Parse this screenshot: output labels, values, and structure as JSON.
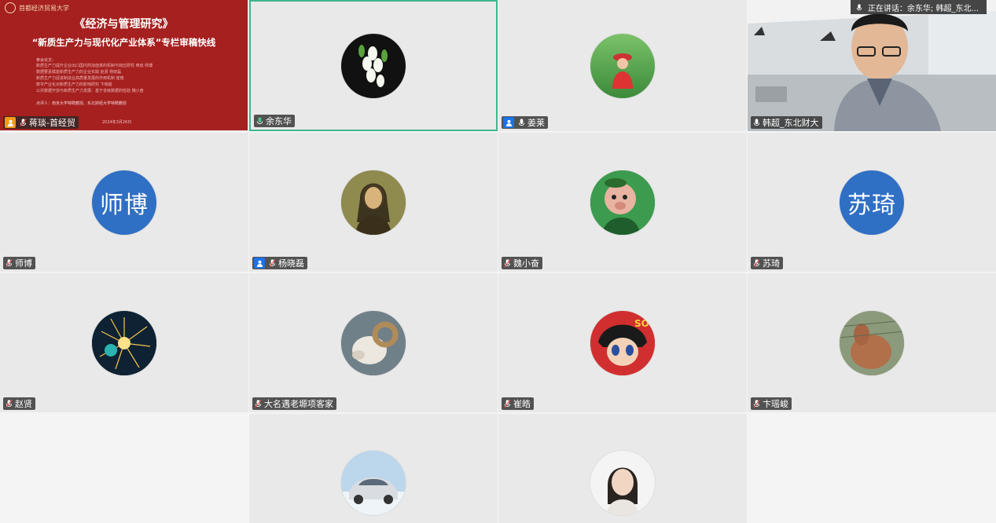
{
  "speaking": {
    "label": "正在讲话：余东华; 韩超_东北..."
  },
  "slide": {
    "org": "首都经济贸易大学",
    "title": "《经济与管理研究》",
    "subtitle": "“新质生产力与现代化产业体系”专栏审稿快线",
    "papers_heading": "参会论文：",
    "papers": [
      "新质生产力提升企业出口国内附加值率的机制与效应研究  蒋琰 师博",
      "数据要素赋能新质生产力的企业实践  赵贤 杨晓磊",
      "新质生产力促进制造业高质量发展的作用机制  崔皓",
      "数字产业化对新质生产力的影响研究  卞瑶峻",
      "公共数据开放与新质生产力发展：基于省级数据的检验  魏小奋"
    ],
    "reviewers": "点评人：南京大学特聘教授、东北财经大学特聘教授",
    "date": "2024年3月26日"
  },
  "participants": [
    {
      "name": "蒋琰-首经贸",
      "avatar": "slide",
      "pin": "orange"
    },
    {
      "name": "余东华",
      "avatar": "flower",
      "active": true
    },
    {
      "name": "姜莱",
      "avatar": "woman-field",
      "pin": "blue"
    },
    {
      "name": "韩超_东北财大",
      "avatar": "video"
    },
    {
      "name": "师博",
      "avatar": "text",
      "avatar_text": "师博"
    },
    {
      "name": "杨晓磊",
      "avatar": "mona-lisa",
      "pin": "blue"
    },
    {
      "name": "魏小奋",
      "avatar": "cartoon-pig"
    },
    {
      "name": "苏琦",
      "avatar": "text",
      "avatar_text": "苏琦"
    },
    {
      "name": "赵贤",
      "avatar": "firework"
    },
    {
      "name": "大名遇老塬项客家",
      "avatar": "ram"
    },
    {
      "name": "崔皓",
      "avatar": "anime"
    },
    {
      "name": "卞瑶峻",
      "avatar": "alpaca"
    },
    {
      "name": "",
      "avatar": "empty"
    },
    {
      "name": "",
      "avatar": "car"
    },
    {
      "name": "",
      "avatar": "woman-portrait"
    }
  ],
  "colors": {
    "active_border": "#3fb58c",
    "pin_blue": "#1b73e8",
    "pin_orange": "#f39a1a",
    "text_avatar": "#2f6fc4"
  }
}
